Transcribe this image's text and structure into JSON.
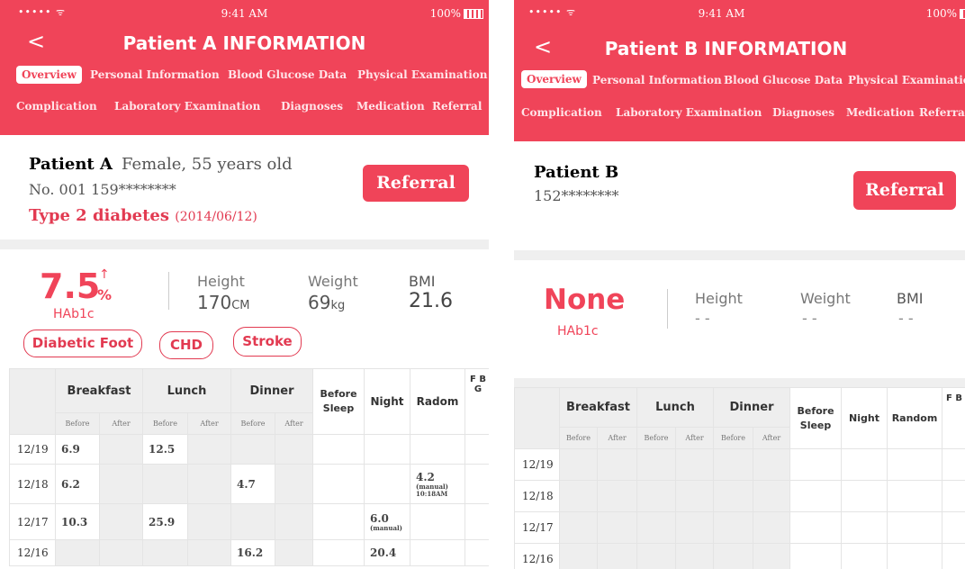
{
  "status_bar": {
    "signal": "••••• ᯤ",
    "time": "9:41 AM",
    "battery": "100%"
  },
  "colors": {
    "accent": "#f04459",
    "high": "#e23a51",
    "normal": "#1a9e3f",
    "low": "#f5b400"
  },
  "icons": {
    "back": "chevron-left-icon",
    "trend": "arrow-up-icon"
  },
  "patient_a": {
    "back": "<",
    "title": "Patient A   INFORMATION",
    "tabs": [
      "Overview",
      "Personal Information",
      "Blood Glucose Data",
      "Physical Examination",
      "Complication",
      "Laboratory Examination",
      "Diagnoses",
      "Medication",
      "Referral"
    ],
    "name": "Patient A",
    "demographics": "Female, 55 years old",
    "id_phone": "No. 001  159********",
    "diagnosis": "Type 2 diabetes",
    "diagnosis_date": "(2014/06/12)",
    "referral_button": "Referral",
    "hba1c_value": "7.5",
    "hba1c_trend": "↑",
    "hba1c_unit": "%",
    "hba1c_label": "HAb1c",
    "height_label": "Height",
    "height_value": "170",
    "height_unit": "CM",
    "weight_label": "Weight",
    "weight_value": "69",
    "weight_unit": "kg",
    "bmi_label": "BMI",
    "bmi_value": "21.6",
    "complications": [
      "Diabetic Foot",
      "CHD",
      "Stroke"
    ],
    "table": {
      "meals": [
        "Breakfast",
        "Lunch",
        "Dinner"
      ],
      "sub": [
        "Before",
        "After"
      ],
      "before_sleep": "Before Sleep",
      "night": "Night",
      "random": "Radom",
      "fbg": "F B G",
      "rows": [
        {
          "date": "12/19",
          "cells": [
            {
              "i": 0,
              "v": "6.9",
              "c": "yellow"
            },
            {
              "i": 2,
              "v": "12.5",
              "c": "red"
            }
          ]
        },
        {
          "date": "12/18",
          "cells": [
            {
              "i": 0,
              "v": "6.2",
              "c": "green"
            },
            {
              "i": 4,
              "v": "4.7",
              "c": "green"
            },
            {
              "i": 8,
              "v": "4.2",
              "c": "yellow",
              "note": "(manual)",
              "note2": "10:18AM"
            }
          ]
        },
        {
          "date": "12/17",
          "cells": [
            {
              "i": 0,
              "v": "10.3",
              "c": "red"
            },
            {
              "i": 2,
              "v": "25.9",
              "c": "red"
            },
            {
              "i": 7,
              "v": "6.0",
              "c": "green",
              "note": "(manual)"
            }
          ]
        },
        {
          "date": "12/16",
          "cells": [
            {
              "i": 4,
              "v": "16.2",
              "c": "red"
            },
            {
              "i": 7,
              "v": "20.4",
              "c": "red"
            }
          ]
        }
      ]
    }
  },
  "patient_b": {
    "back": "<",
    "title": "Patient B   INFORMATION",
    "tabs": [
      "Overview",
      "Personal Information",
      "Blood Glucose Data",
      "Physical Examination",
      "Complication",
      "Laboratory Examination",
      "Diagnoses",
      "Medication",
      "Referral"
    ],
    "name": "Patient B",
    "phone": "152********",
    "referral_button": "Referral",
    "hba1c_value": "None",
    "hba1c_label": "HAb1c",
    "height_label": "Height",
    "height_value": "- -",
    "weight_label": "Weight",
    "weight_value": "- -",
    "bmi_label": "BMI",
    "bmi_value": "- -",
    "table": {
      "meals": [
        "Breakfast",
        "Lunch",
        "Dinner"
      ],
      "sub": [
        "Before",
        "After"
      ],
      "before_sleep": "Before Sleep",
      "night": "Night",
      "random": "Random",
      "fbg": "F B G",
      "dates": [
        "12/19",
        "12/18",
        "12/17",
        "12/16"
      ]
    }
  }
}
